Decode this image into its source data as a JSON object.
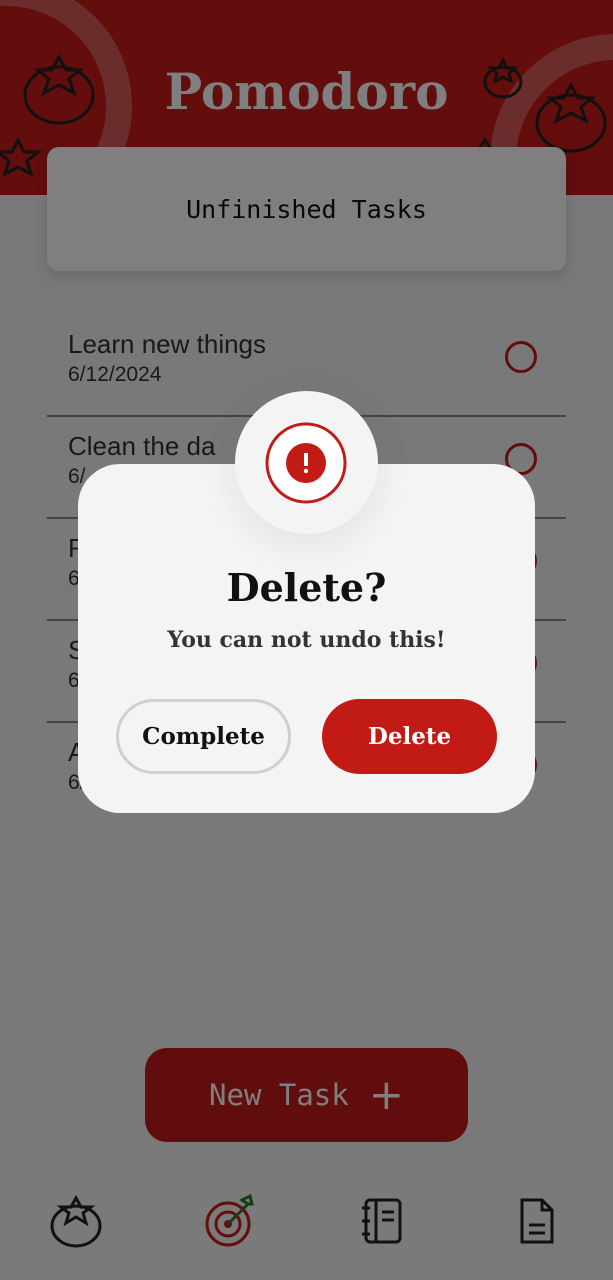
{
  "app": {
    "title": "Pomodoro"
  },
  "card": {
    "title": "Unfinished Tasks"
  },
  "tasks": [
    {
      "title": "Learn new things",
      "date": "6/12/2024"
    },
    {
      "title": "Clean the da",
      "date": "6/"
    },
    {
      "title": "R",
      "date": "6"
    },
    {
      "title": "S",
      "date": "6"
    },
    {
      "title": "A",
      "date": "6/"
    }
  ],
  "new_task": {
    "label": "New Task",
    "icon": "plus-icon"
  },
  "nav": {
    "items": [
      "tomato-icon",
      "target-icon",
      "notebook-icon",
      "document-icon"
    ]
  },
  "dialog": {
    "title": "Delete?",
    "message": "You can not undo this!",
    "complete_label": "Complete",
    "delete_label": "Delete",
    "icon": "alert-icon"
  },
  "colors": {
    "accent": "#c61a1a",
    "overlay": "rgba(0,0,0,0.5)",
    "surface": "#f4f4f4"
  }
}
